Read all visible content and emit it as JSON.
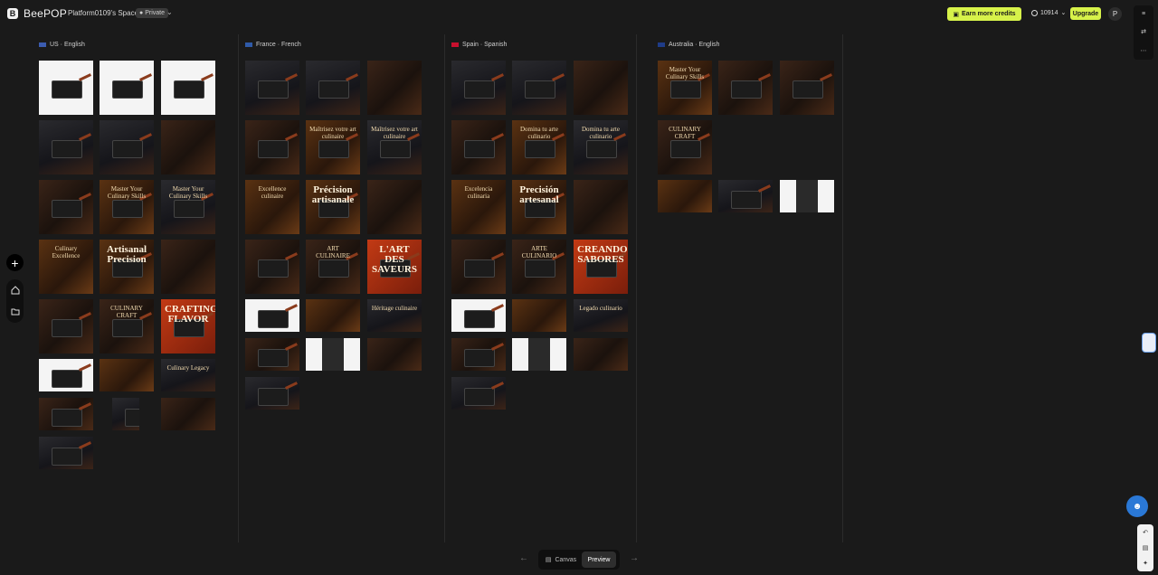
{
  "app": {
    "brand": "BeePOP",
    "space_name": "Platform0109's Space",
    "visibility": "Private",
    "earn_label": "Earn more credits",
    "credits": "10914",
    "upgrade_label": "Upgrade",
    "avatar_initial": "P"
  },
  "colors": {
    "accent": "#d7f24a",
    "background": "#1a1a1a",
    "help": "#2a78d6"
  },
  "columns": [
    {
      "title": "US · English",
      "flag": "us",
      "thumbs": [
        {
          "style": "t-white",
          "pan": true,
          "text": ""
        },
        {
          "style": "t-white",
          "pan": true,
          "text": ""
        },
        {
          "style": "t-white",
          "pan": true,
          "text": ""
        },
        {
          "style": "t-dark2",
          "pan": true,
          "text": ""
        },
        {
          "style": "t-dark2",
          "pan": true,
          "text": ""
        },
        {
          "style": "t-dark",
          "pan": false,
          "text": ""
        },
        {
          "style": "t-dark",
          "pan": true,
          "text": ""
        },
        {
          "style": "t-warm",
          "pan": true,
          "text": "Master Your Culinary Skills"
        },
        {
          "style": "t-dark2",
          "pan": true,
          "text": "Master Your Culinary Skills"
        },
        {
          "style": "t-warm",
          "pan": false,
          "text": "Culinary Excellence"
        },
        {
          "style": "t-warm",
          "pan": true,
          "text": "Artisanal Precision",
          "big": true
        },
        {
          "style": "t-dark",
          "pan": false,
          "text": ""
        },
        {
          "style": "t-dark",
          "pan": true,
          "text": ""
        },
        {
          "style": "t-dark",
          "pan": true,
          "text": "CULINARY CRAFT"
        },
        {
          "style": "t-red",
          "pan": true,
          "text": "CRAFTING FLAVOR",
          "big": true
        },
        {
          "style": "t-white",
          "pan": true,
          "text": "",
          "short": true
        },
        {
          "style": "t-warm",
          "pan": false,
          "text": "",
          "short": true
        },
        {
          "style": "t-dark2",
          "pan": false,
          "text": "Culinary Legacy",
          "short": true
        },
        {
          "style": "t-dark",
          "pan": true,
          "text": "",
          "short": true
        },
        {
          "style": "t-dark2",
          "pan": true,
          "text": "",
          "short": true,
          "narrow": true
        },
        {
          "style": "t-dark",
          "pan": false,
          "text": "",
          "short": true
        },
        {
          "style": "t-dark2",
          "pan": true,
          "text": "",
          "short": true
        }
      ]
    },
    {
      "title": "France · French",
      "flag": "fr",
      "thumbs": [
        {
          "style": "t-dark2",
          "pan": true,
          "text": ""
        },
        {
          "style": "t-dark2",
          "pan": true,
          "text": ""
        },
        {
          "style": "t-dark",
          "pan": false,
          "text": ""
        },
        {
          "style": "t-dark",
          "pan": true,
          "text": ""
        },
        {
          "style": "t-warm",
          "pan": true,
          "text": "Maîtrisez votre art culinaire"
        },
        {
          "style": "t-dark2",
          "pan": true,
          "text": "Maîtrisez votre art culinaire"
        },
        {
          "style": "t-warm",
          "pan": false,
          "text": "Excellence culinaire"
        },
        {
          "style": "t-warm",
          "pan": true,
          "text": "Précision artisanale",
          "big": true
        },
        {
          "style": "t-dark",
          "pan": false,
          "text": ""
        },
        {
          "style": "t-dark",
          "pan": true,
          "text": ""
        },
        {
          "style": "t-dark",
          "pan": true,
          "text": "ART CULINAIRE"
        },
        {
          "style": "t-red",
          "pan": true,
          "text": "L'ART DES SAVEURS",
          "big": true
        },
        {
          "style": "t-white",
          "pan": true,
          "text": "",
          "short": true
        },
        {
          "style": "t-warm",
          "pan": false,
          "text": "",
          "short": true
        },
        {
          "style": "t-dark2",
          "pan": false,
          "text": "Héritage culinaire",
          "short": true
        },
        {
          "style": "t-dark",
          "pan": true,
          "text": "",
          "short": true
        },
        {
          "style": "t-mixed",
          "pan": false,
          "text": "",
          "short": true
        },
        {
          "style": "t-dark",
          "pan": false,
          "text": "",
          "short": true
        },
        {
          "style": "t-dark2",
          "pan": true,
          "text": "",
          "short": true
        }
      ]
    },
    {
      "title": "Spain · Spanish",
      "flag": "es",
      "thumbs": [
        {
          "style": "t-dark2",
          "pan": true,
          "text": ""
        },
        {
          "style": "t-dark2",
          "pan": true,
          "text": ""
        },
        {
          "style": "t-dark",
          "pan": false,
          "text": ""
        },
        {
          "style": "t-dark",
          "pan": true,
          "text": ""
        },
        {
          "style": "t-warm",
          "pan": true,
          "text": "Domina tu arte culinario"
        },
        {
          "style": "t-dark2",
          "pan": true,
          "text": "Domina tu arte culinario"
        },
        {
          "style": "t-warm",
          "pan": false,
          "text": "Excelencia culinaria"
        },
        {
          "style": "t-warm",
          "pan": true,
          "text": "Precisión artesanal",
          "big": true
        },
        {
          "style": "t-dark",
          "pan": false,
          "text": ""
        },
        {
          "style": "t-dark",
          "pan": true,
          "text": ""
        },
        {
          "style": "t-dark",
          "pan": true,
          "text": "ARTE CULINARIO"
        },
        {
          "style": "t-red",
          "pan": true,
          "text": "CREANDO SABORES",
          "big": true
        },
        {
          "style": "t-white",
          "pan": true,
          "text": "",
          "short": true
        },
        {
          "style": "t-warm",
          "pan": false,
          "text": "",
          "short": true
        },
        {
          "style": "t-dark2",
          "pan": false,
          "text": "Legado culinario",
          "short": true
        },
        {
          "style": "t-dark",
          "pan": true,
          "text": "",
          "short": true
        },
        {
          "style": "t-mixed",
          "pan": false,
          "text": "",
          "short": true
        },
        {
          "style": "t-dark",
          "pan": false,
          "text": "",
          "short": true
        },
        {
          "style": "t-dark2",
          "pan": true,
          "text": "",
          "short": true
        }
      ]
    },
    {
      "title": "Australia · English",
      "flag": "au",
      "thumbs": [
        {
          "style": "t-warm",
          "pan": true,
          "text": "Master Your Culinary Skills"
        },
        {
          "style": "t-dark",
          "pan": true,
          "text": ""
        },
        {
          "style": "t-dark",
          "pan": true,
          "text": ""
        },
        {
          "style": "t-dark",
          "pan": true,
          "text": "CULINARY CRAFT"
        },
        {
          "style": "t-warm",
          "pan": false,
          "text": "",
          "short": true
        },
        {
          "style": "t-dark2",
          "pan": true,
          "text": "",
          "short": true
        },
        {
          "style": "t-mixed",
          "pan": false,
          "text": "",
          "short": true
        }
      ]
    }
  ],
  "bottom": {
    "canvas_label": "Canvas",
    "preview_label": "Preview"
  }
}
